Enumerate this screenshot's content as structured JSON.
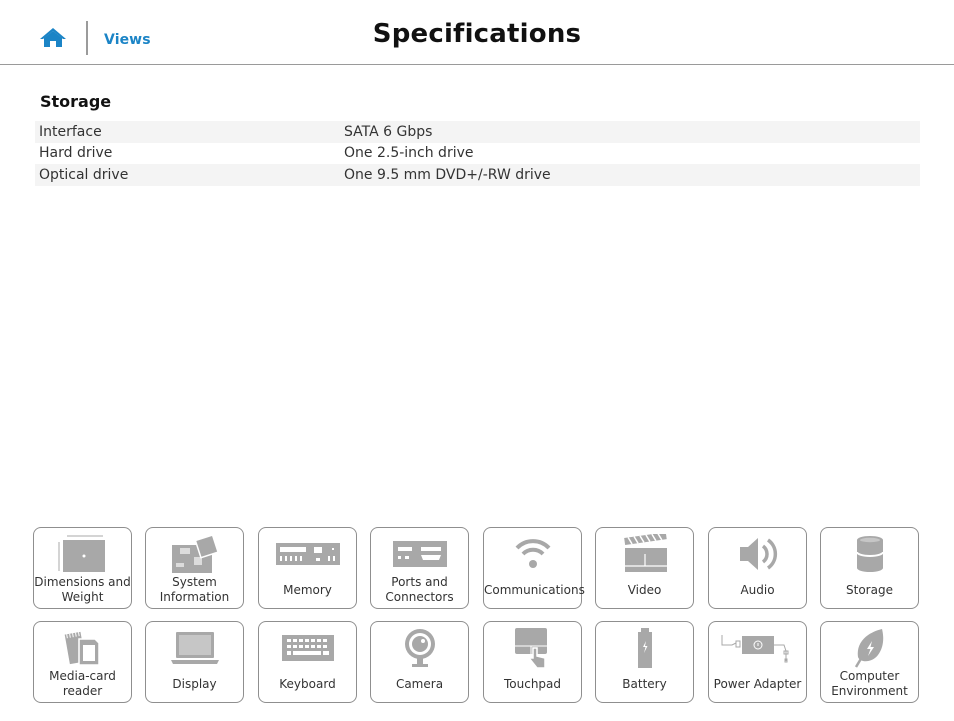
{
  "header": {
    "home_icon": "home-icon",
    "views_link": "Views",
    "title": "Specifications"
  },
  "section": {
    "title": "Storage",
    "rows": [
      {
        "label": "Interface",
        "value": "SATA 6 Gbps"
      },
      {
        "label": "Hard drive",
        "value": "One 2.5-inch drive"
      },
      {
        "label": "Optical drive",
        "value": "One 9.5 mm DVD+/-RW drive"
      }
    ]
  },
  "tiles": [
    {
      "label": "Dimensions and Weight",
      "icon": "laptop-dimensions-icon"
    },
    {
      "label": "System Information",
      "icon": "motherboard-icon"
    },
    {
      "label": "Memory",
      "icon": "memory-module-icon"
    },
    {
      "label": "Ports and Connectors",
      "icon": "ports-icon"
    },
    {
      "label": "Communications",
      "icon": "wifi-icon"
    },
    {
      "label": "Video",
      "icon": "clapperboard-icon"
    },
    {
      "label": "Audio",
      "icon": "speaker-icon"
    },
    {
      "label": "Storage",
      "icon": "storage-cylinder-icon"
    },
    {
      "label": "Media-card reader",
      "icon": "media-card-icon"
    },
    {
      "label": "Display",
      "icon": "laptop-display-icon"
    },
    {
      "label": "Keyboard",
      "icon": "keyboard-icon"
    },
    {
      "label": "Camera",
      "icon": "webcam-icon"
    },
    {
      "label": "Touchpad",
      "icon": "touchpad-icon"
    },
    {
      "label": "Battery",
      "icon": "battery-icon"
    },
    {
      "label": "Power Adapter",
      "icon": "power-adapter-icon"
    },
    {
      "label": "Computer Environment",
      "icon": "leaf-icon"
    }
  ],
  "colors": {
    "accent": "#1b84c6",
    "icon_gray": "#a8a8a8",
    "row_shade": "#f4f4f4"
  }
}
